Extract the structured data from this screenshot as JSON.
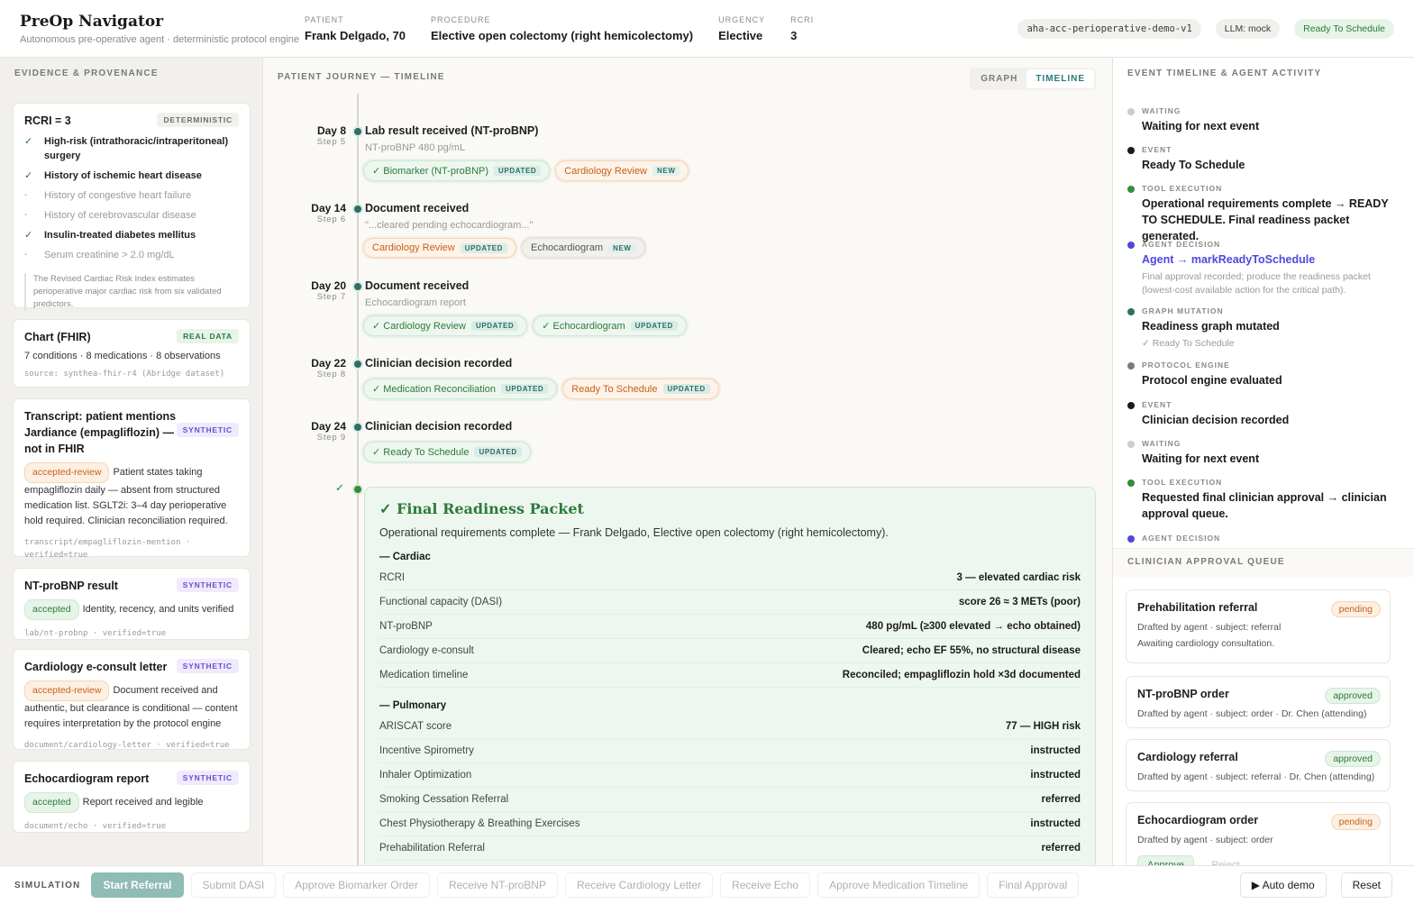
{
  "header": {
    "title": "PreOp Navigator",
    "subtitle": "Autonomous pre-operative agent · deterministic protocol engine",
    "fields": [
      {
        "label": "PATIENT",
        "value": "Frank Delgado, 70"
      },
      {
        "label": "PROCEDURE",
        "value": "Elective open colectomy (right hemicolectomy)"
      },
      {
        "label": "URGENCY",
        "value": "Elective"
      },
      {
        "label": "RCRI",
        "value": "3"
      }
    ],
    "pills": {
      "protocol": "aha-acc-perioperative-demo-v1",
      "llm": "LLM: mock",
      "status": "Ready To Schedule"
    }
  },
  "left": {
    "title": "EVIDENCE & PROVENANCE",
    "rcri": {
      "title": "RCRI = 3",
      "tag": "DETERMINISTIC",
      "criteria": [
        {
          "mark": "✓",
          "text": "High-risk (intrathoracic/intraperitoneal) surgery"
        },
        {
          "mark": "✓",
          "text": "History of ischemic heart disease"
        },
        {
          "mark": "·",
          "text": "History of congestive heart failure"
        },
        {
          "mark": "·",
          "text": "History of cerebrovascular disease"
        },
        {
          "mark": "✓",
          "text": "Insulin-treated diabetes mellitus"
        },
        {
          "mark": "·",
          "text": "Serum creatinine > 2.0 mg/dL"
        }
      ],
      "note": "The Revised Cardiac Risk Index estimates perioperative major cardiac risk from six validated predictors."
    },
    "chart": {
      "title": "Chart (FHIR)",
      "tag": "REAL DATA",
      "body": "7 conditions · 8 medications · 8 observations",
      "source": "source: synthea-fhir-r4 (Abridge dataset)"
    },
    "transcript": {
      "title": "Transcript: patient mentions Jardiance (empagliflozin) — not in FHIR",
      "tag": "SYNTHETIC",
      "status": "accepted-review",
      "body": "Patient states taking empagliflozin daily — absent from structured medication list. SGLT2i: 3–4 day perioperative hold required. Clinician reconciliation required.",
      "source": "transcript/empagliflozin-mention · verified=true"
    },
    "ntprobnp": {
      "title": "NT-proBNP result",
      "tag": "SYNTHETIC",
      "status": "accepted",
      "body": "Identity, recency, and units verified",
      "source": "lab/nt-probnp · verified=true"
    },
    "cardio": {
      "title": "Cardiology e-consult letter",
      "tag": "SYNTHETIC",
      "status": "accepted-review",
      "body": "Document received and authentic, but clearance is conditional — content requires interpretation by the protocol engine",
      "source": "document/cardiology-letter · verified=true"
    },
    "echo": {
      "title": "Echocardiogram report",
      "tag": "SYNTHETIC",
      "status": "accepted",
      "body": "Report received and legible",
      "source": "document/echo · verified=true"
    }
  },
  "center": {
    "title": "PATIENT JOURNEY — TIMELINE",
    "toggle": {
      "graph": "GRAPH",
      "timeline": "TIMELINE"
    },
    "steps": [
      {
        "day": "Day 8",
        "step": "Step 5",
        "title": "Lab result received (NT-proBNP)",
        "sub": "NT-proBNP 480 pg/mL",
        "chips": [
          {
            "text": "✓ Biomarker (NT-proBNP)",
            "badge": "UPDATED"
          },
          {
            "text": "Cardiology Review",
            "badge": "NEW"
          }
        ]
      },
      {
        "day": "Day 14",
        "step": "Step 6",
        "title": "Document received",
        "sub": "\"...cleared pending echocardiogram...\"",
        "chips": [
          {
            "text": "Cardiology Review",
            "badge": "UPDATED"
          },
          {
            "text": "Echocardiogram",
            "badge": "NEW"
          }
        ]
      },
      {
        "day": "Day 20",
        "step": "Step 7",
        "title": "Document received",
        "sub": "Echocardiogram report",
        "chips": [
          {
            "text": "✓ Cardiology Review",
            "badge": "UPDATED"
          },
          {
            "text": "✓ Echocardiogram",
            "badge": "UPDATED"
          }
        ]
      },
      {
        "day": "Day 22",
        "step": "Step 8",
        "title": "Clinician decision recorded",
        "chips": [
          {
            "text": "✓ Medication Reconciliation",
            "badge": "UPDATED"
          },
          {
            "text": "Ready To Schedule",
            "badge": "UPDATED"
          }
        ]
      },
      {
        "day": "Day 24",
        "step": "Step 9",
        "title": "Clinician decision recorded",
        "chips": [
          {
            "text": "✓ Ready To Schedule",
            "badge": "UPDATED"
          }
        ]
      }
    ],
    "packet": {
      "check": "✓",
      "title": "✓ Final Readiness Packet",
      "subtitle": "Operational requirements complete — Frank Delgado, Elective open colectomy (right hemicolectomy).",
      "cardiac_title": "— Cardiac",
      "cardiac": [
        {
          "k": "RCRI",
          "v": "3 — elevated cardiac risk"
        },
        {
          "k": "Functional capacity (DASI)",
          "v": "score 26 ≈ 3 METs (poor)"
        },
        {
          "k": "NT-proBNP",
          "v": "480 pg/mL (≥300 elevated → echo obtained)"
        },
        {
          "k": "Cardiology e-consult",
          "v": "Cleared; echo EF 55%, no structural disease"
        },
        {
          "k": "Medication timeline",
          "v": "Reconciled; empagliflozin hold ×3d documented"
        }
      ],
      "pulm_title": "— Pulmonary",
      "pulm": [
        {
          "k": "ARISCAT score",
          "v": "77 — HIGH risk"
        },
        {
          "k": "Incentive Spirometry",
          "v": "instructed"
        },
        {
          "k": "Inhaler Optimization",
          "v": "instructed"
        },
        {
          "k": "Smoking Cessation Referral",
          "v": "referred"
        },
        {
          "k": "Chest Physiotherapy & Breathing Exercises",
          "v": "instructed"
        },
        {
          "k": "Prehabilitation Referral",
          "v": "referred"
        }
      ]
    }
  },
  "right": {
    "title": "EVENT TIMELINE & AGENT ACTIVITY",
    "events": [
      {
        "type": "WAITING",
        "title": "Waiting for next event",
        "color": "#c9ccd4"
      },
      {
        "type": "EVENT",
        "title": "Ready To Schedule",
        "color": "#1a1a1a"
      },
      {
        "type": "TOOL EXECUTION",
        "title": "Operational requirements complete → READY TO SCHEDULE. Final readiness packet generated.",
        "color": "#3a8a3a"
      },
      {
        "type": "AGENT DECISION",
        "title": "Agent → markReadyToSchedule",
        "desc": "Final approval recorded; produce the readiness packet (lowest-cost available action for the critical path).",
        "color": "#5046e0"
      },
      {
        "type": "GRAPH MUTATION",
        "title": "Readiness graph mutated",
        "desc": "✓ Ready To Schedule",
        "color": "#2f6e63"
      },
      {
        "type": "PROTOCOL ENGINE",
        "title": "Protocol engine evaluated",
        "color": "#7a7a80"
      },
      {
        "type": "EVENT",
        "title": "Clinician decision recorded",
        "color": "#1a1a1a"
      },
      {
        "type": "WAITING",
        "title": "Waiting for next event",
        "color": "#c9ccd4"
      },
      {
        "type": "TOOL EXECUTION",
        "title": "Requested final clinician approval → clinician approval queue.",
        "color": "#3a8a3a"
      },
      {
        "type": "AGENT DECISION",
        "title": "",
        "color": "#5046e0"
      }
    ],
    "queue_title": "CLINICIAN APPROVAL QUEUE",
    "queue": [
      {
        "title": "Prehabilitation referral",
        "status": "pending",
        "sub": "Drafted by agent · subject: referral",
        "sub2": "Awaiting cardiology consultation."
      },
      {
        "title": "NT-proBNP order",
        "status": "approved",
        "sub": "Drafted by agent · subject: order · Dr. Chen (attending)"
      },
      {
        "title": "Cardiology referral",
        "status": "approved",
        "sub": "Drafted by agent · subject: referral · Dr. Chen (attending)"
      },
      {
        "title": "Echocardiogram order",
        "status": "pending",
        "sub": "Drafted by agent · subject: order",
        "approve": "Approve",
        "reject": "Reject"
      }
    ]
  },
  "footer": {
    "label": "SIMULATION",
    "buttons": [
      "Start Referral",
      "Submit DASI",
      "Approve Biomarker Order",
      "Receive NT-proBNP",
      "Receive Cardiology Letter",
      "Receive Echo",
      "Approve Medication Timeline",
      "Final Approval"
    ],
    "auto": "▶ Auto demo",
    "reset": "Reset"
  }
}
